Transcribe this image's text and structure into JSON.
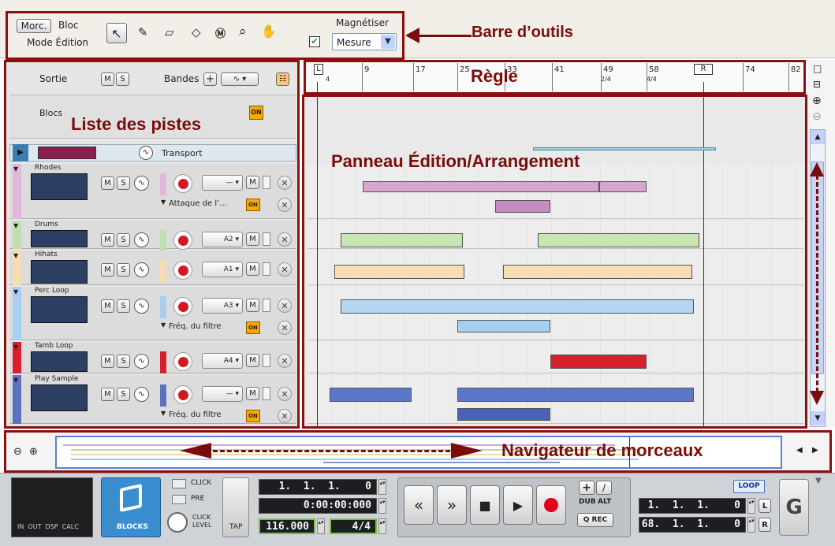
{
  "toolbar": {
    "mode_left": "Morc.",
    "mode_right": "Bloc",
    "mode_caption": "Mode Édition",
    "snap_label": "Magnétiser",
    "snap_value": "Mesure"
  },
  "annotations": {
    "toolbar": "Barre d’outils",
    "ruler": "Règle",
    "tracklist": "Liste des pistes",
    "edit_panel": "Panneau Édition/Arrangement",
    "navigator": "Navigateur de morceaux"
  },
  "tracklist_header": {
    "sortie": "Sortie",
    "bandes": "Bandes",
    "m": "M",
    "s": "S",
    "blocs": "Blocs",
    "on": "ON"
  },
  "transport_track": {
    "label": "Transport"
  },
  "tracks": [
    {
      "name": "Rhodes",
      "sel": "—",
      "lane_label": "Attaque de l’...",
      "color": "#e2b8d8"
    },
    {
      "name": "Drums",
      "sel": "A2",
      "color": "#bfe0a8"
    },
    {
      "name": "Hihats",
      "sel": "A1",
      "color": "#f6dcb0"
    },
    {
      "name": "Perc Loop",
      "sel": "A3",
      "lane_label": "Fréq. du filtre",
      "color": "#a8cff0"
    },
    {
      "name": "Tamb Loop",
      "sel": "A4",
      "color": "#d8202c"
    },
    {
      "name": "Play Sample",
      "sel": "—",
      "lane_label": "Fréq. du filtre",
      "color": "#5a72c0"
    }
  ],
  "ruler": {
    "ticks": [
      "9",
      "17",
      "25",
      "33",
      "41",
      "49",
      "58",
      "74",
      "82"
    ],
    "sig_49": "2/4",
    "sig_58": "4/4",
    "L": "L",
    "R": "R",
    "sig_start": "4"
  },
  "transport": {
    "click": "CLICK",
    "pre": "PRE",
    "click_level": "CLICK LEVEL",
    "tap": "TAP",
    "blocks": "BLOCKS",
    "meter_label": "IN  OUT  DSP  CALC",
    "position": "1.  1.  1.    0",
    "time": "0:00:00:000",
    "tempo": "116.000",
    "signature": "4/4",
    "dub": "DUB",
    "alt": "ALT",
    "qrec": "Q REC",
    "loop": "LOOP",
    "loop_left": "1.  1.  1.    0",
    "loop_right": "68.  1.  1.    0",
    "L": "L",
    "R": "R"
  }
}
